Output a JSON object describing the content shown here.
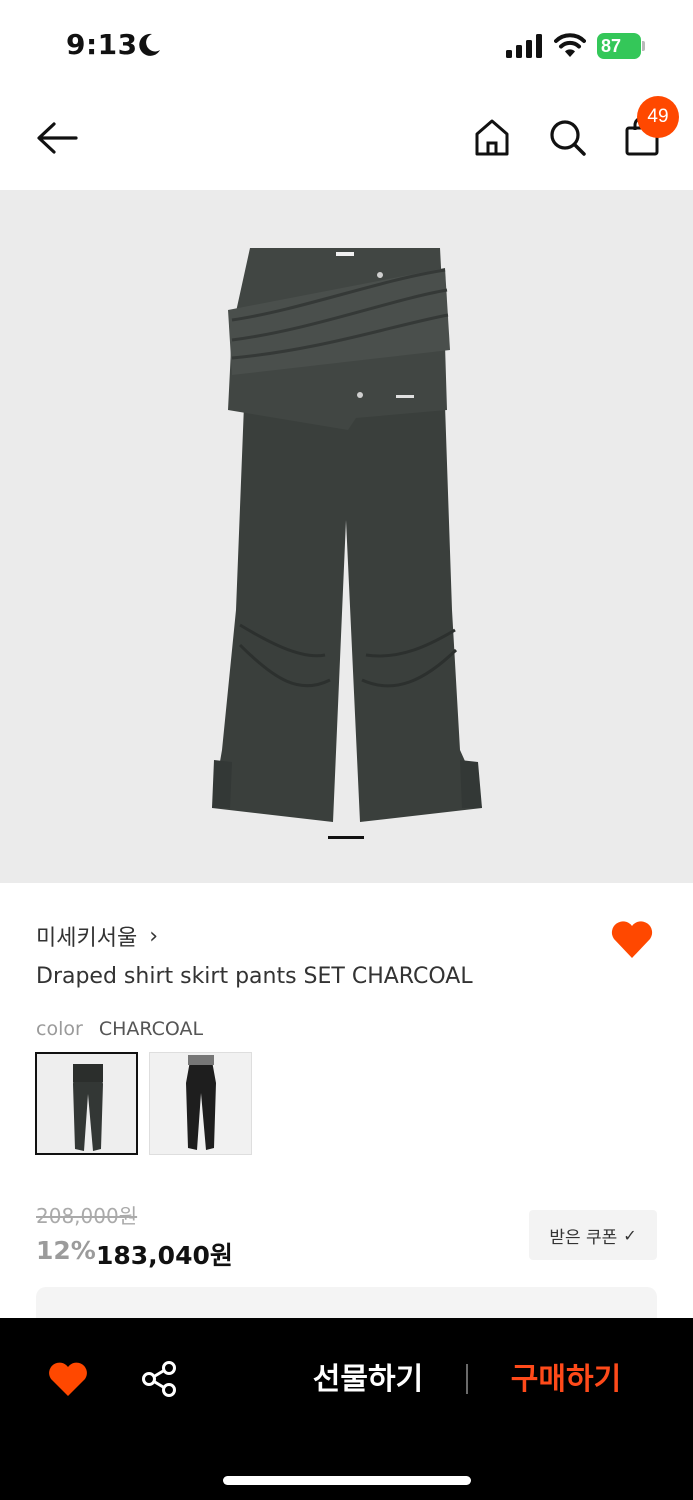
{
  "status_bar": {
    "time": "9:13",
    "battery_level": "87",
    "icons": [
      "moon-icon",
      "signal-icon",
      "wifi-icon",
      "battery-icon"
    ]
  },
  "nav": {
    "icons": [
      "back-arrow-icon",
      "home-icon",
      "search-icon",
      "shopping-bag-icon"
    ],
    "cart_count": "49"
  },
  "product": {
    "brand": "미세키서울",
    "brand_chevron": "›",
    "title": "Draped shirt skirt pants SET CHARCOAL",
    "liked": true,
    "color_label": "color",
    "color_value": "CHARCOAL",
    "original_price": "208,000원",
    "discount_rate": "12%",
    "sale_price": "183,040원",
    "coupon_label": "받은 쿠폰",
    "coupon_check": "✓",
    "colors": {
      "accent": "#ff4800",
      "garment": "#3a3f3c"
    }
  },
  "bottom_bar": {
    "gift_label": "선물하기",
    "buy_label": "구매하기",
    "icons": [
      "heart-icon",
      "share-icon"
    ]
  }
}
